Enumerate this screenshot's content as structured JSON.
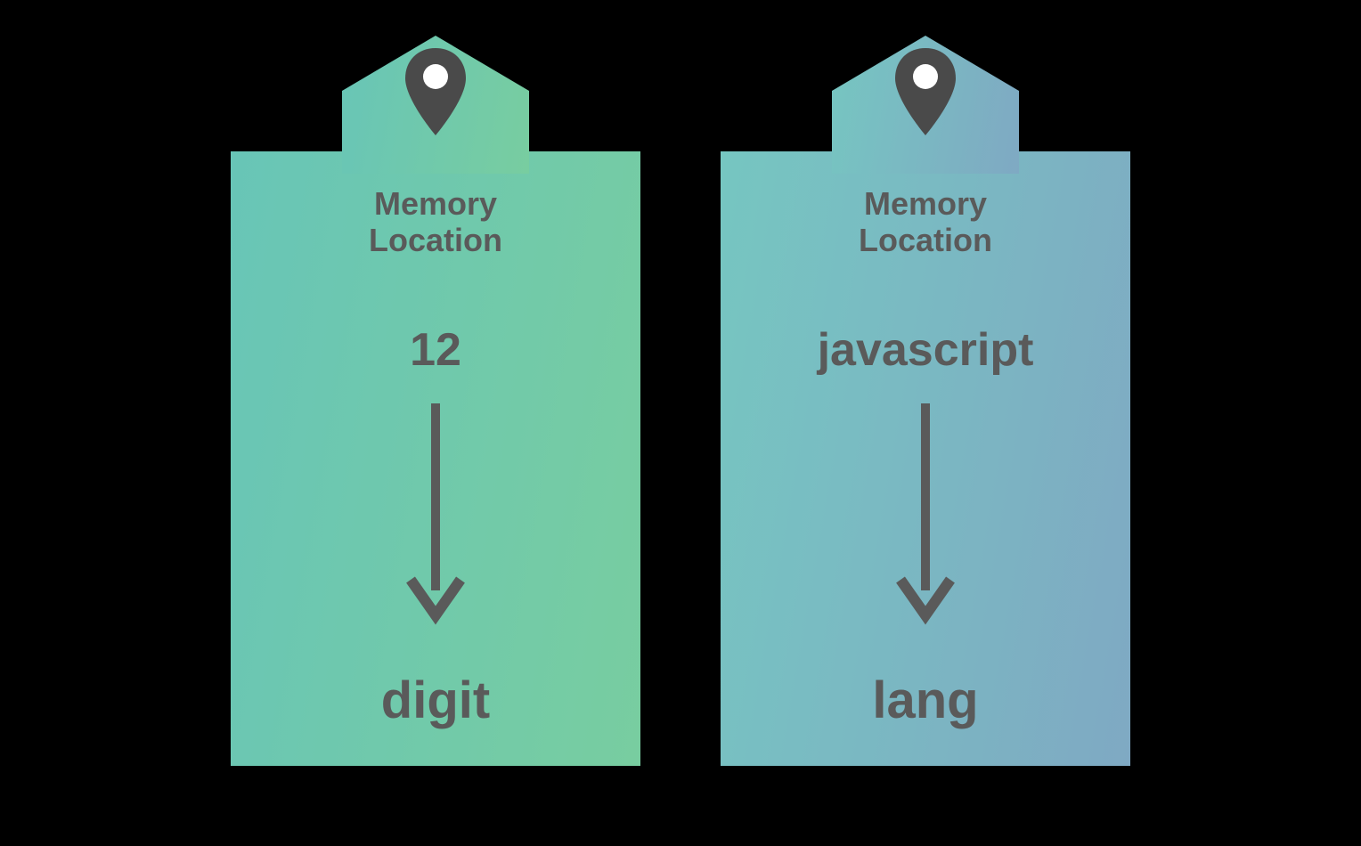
{
  "cards": [
    {
      "label_line1": "Memory",
      "label_line2": "Location",
      "value": "12",
      "varname": "digit",
      "gradient": "grad-green"
    },
    {
      "label_line1": "Memory",
      "label_line2": "Location",
      "value": "javascript",
      "varname": "lang",
      "gradient": "grad-blue"
    }
  ],
  "colors": {
    "text": "#5a5a5a",
    "arrow": "#5a5a5a",
    "pin_body": "#4a4a4a",
    "pin_dot": "#ffffff"
  }
}
